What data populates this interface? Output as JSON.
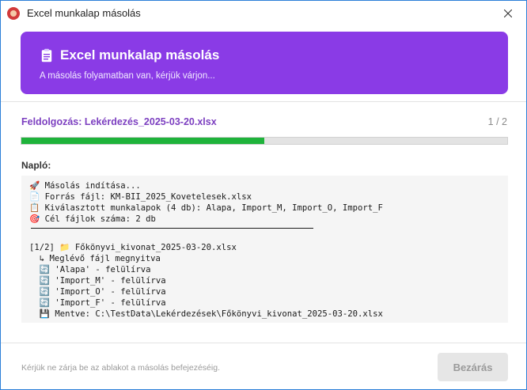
{
  "window": {
    "title": "Excel munkalap másolás"
  },
  "header": {
    "title": "Excel munkalap másolás",
    "subtitle": "A másolás folyamatban van, kérjük várjon..."
  },
  "status": {
    "processing_text": "Feldolgozás: Lekérdezés_2025-03-20.xlsx",
    "counter": "1 / 2",
    "progress_fraction": 0.5
  },
  "log": {
    "label": "Napló:",
    "lines": [
      "🚀 Másolás indítása...",
      "📄 Forrás fájl: KM-BII_2025_Kovetelesek.xlsx",
      "📋 Kiválasztott munkalapok (4 db): Alapa, Import_M, Import_O, Import_F",
      "🎯 Cél fájlok száma: 2 db",
      "[1/2] 📁 Főkönyvi_kivonat_2025-03-20.xlsx",
      "  ↳ Meglévő fájl megnyitva",
      "  🔄 'Alapa' - felülírva",
      "  🔄 'Import_M' - felülírva",
      "  🔄 'Import_O' - felülírva",
      "  🔄 'Import_F' - felülírva",
      "  💾 Mentve: C:\\TestData\\Lekérdezések\\Főkönyvi_kivonat_2025-03-20.xlsx"
    ]
  },
  "footer": {
    "note": "Kérjük ne zárja be az ablakot a másolás befejezéséig.",
    "close_label": "Bezárás"
  },
  "colors": {
    "accent": "#8a3be6",
    "progress": "#1fb33b",
    "status_text": "#7c3fc0"
  }
}
